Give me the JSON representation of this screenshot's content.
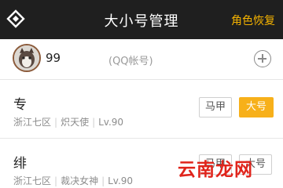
{
  "header": {
    "title": "大小号管理",
    "role_restore_label": "角色恢复"
  },
  "account": {
    "id_prefix": "99",
    "type_label": "(QQ帐号)"
  },
  "roles": [
    {
      "name": "专",
      "server": "浙江七区",
      "class": "炽天使",
      "level": "Lv.90",
      "buttons": [
        "马甲",
        "大号"
      ],
      "selected": "大号"
    },
    {
      "name": "绯",
      "server": "浙江七区",
      "class": "裁决女神",
      "level": "Lv.90",
      "buttons": [
        "马甲",
        "大号"
      ],
      "selected": "马甲"
    }
  ],
  "watermark": "云南龙网",
  "colors": {
    "header_bg": "#1f1f1f",
    "accent": "#f7b01a",
    "watermark": "#e0241b"
  }
}
